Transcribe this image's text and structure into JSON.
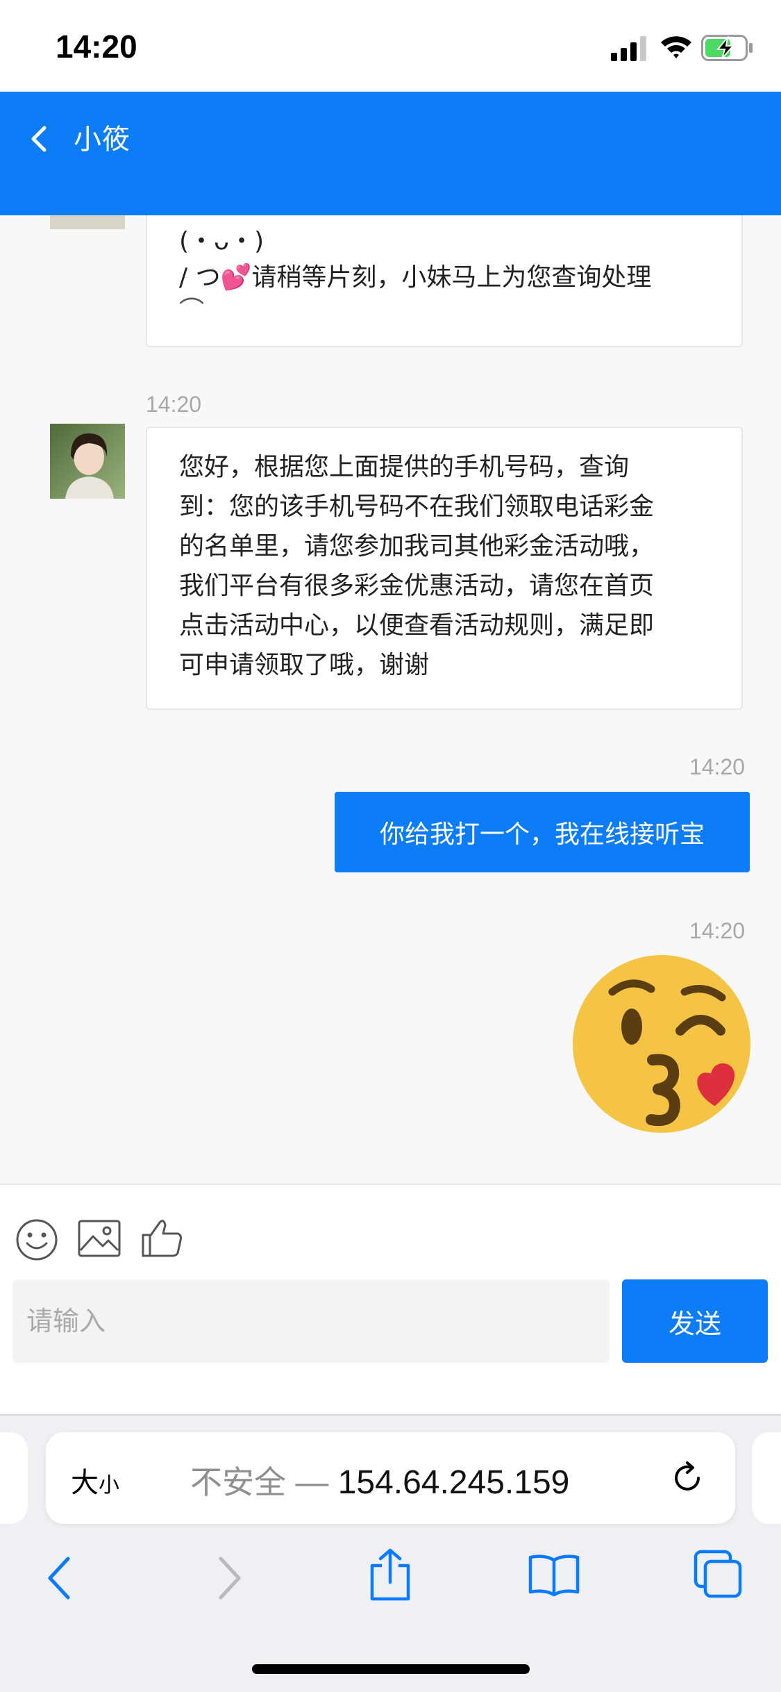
{
  "status_bar": {
    "time": "14:20",
    "icons": [
      "cellular-signal-icon",
      "wifi-icon",
      "battery-charging-icon"
    ],
    "battery_color": "#4cd964"
  },
  "header": {
    "title": "小筱",
    "background_color": "#0c7cf7",
    "back_icon": "chevron-left-icon"
  },
  "messages": [
    {
      "side": "left",
      "sender_avatar": "avatar-image",
      "lines": [
        "(・ᴗ・)",
        "/ つ💕请稍等片刻，小妹马上为您查询处理",
        "⌒"
      ]
    },
    {
      "side": "left",
      "time": "14:20",
      "sender_avatar": "avatar-image",
      "lines": [
        "您好，根据您上面提供的手机号码，查询",
        "到：您的该手机号码不在我们领取电话彩金",
        "的名单里，请您参加我司其他彩金活动哦，",
        "我们平台有很多彩金优惠活动，请您在首页",
        "点击活动中心，以便查看活动规则，满足即",
        "可申请领取了哦，谢谢"
      ]
    },
    {
      "side": "right",
      "time": "14:20",
      "text": "你给我打一个，我在线接听宝"
    },
    {
      "side": "right",
      "time": "14:20",
      "type": "emoji",
      "emoji_name": "face-blowing-a-kiss-emoji"
    }
  ],
  "input_area": {
    "tools": [
      "smiley-icon",
      "image-icon",
      "thumbs-up-icon"
    ],
    "placeholder": "请输入",
    "send_label": "发送"
  },
  "browser": {
    "text_size_label_big": "大",
    "text_size_label_small": "小",
    "insecure_label": "不安全",
    "separator": "—",
    "host": "154.64.245.159",
    "nav_icons": [
      "back-arrow-icon",
      "forward-arrow-icon",
      "share-icon",
      "bookmarks-icon",
      "tabs-icon"
    ]
  }
}
